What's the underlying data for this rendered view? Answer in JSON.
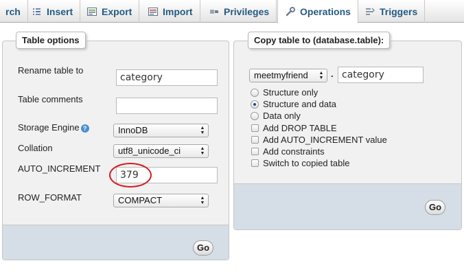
{
  "tabs": [
    {
      "label": "rch",
      "icon": "search-icon"
    },
    {
      "label": "Insert",
      "icon": "insert-icon"
    },
    {
      "label": "Export",
      "icon": "export-icon"
    },
    {
      "label": "Import",
      "icon": "import-icon"
    },
    {
      "label": "Privileges",
      "icon": "privileges-icon"
    },
    {
      "label": "Operations",
      "icon": "wrench-icon",
      "active": true
    },
    {
      "label": "Triggers",
      "icon": "triggers-icon"
    }
  ],
  "table_options": {
    "legend": "Table options",
    "rename_label": "Rename table to",
    "rename_value": "category",
    "comments_label": "Table comments",
    "comments_value": "",
    "engine_label": "Storage Engine",
    "engine_value": "InnoDB",
    "collation_label": "Collation",
    "collation_value": "utf8_unicode_ci",
    "auto_inc_label": "AUTO_INCREMENT",
    "auto_inc_value": "379",
    "row_format_label": "ROW_FORMAT",
    "row_format_value": "COMPACT",
    "go_label": "Go"
  },
  "copy_table": {
    "legend": "Copy table to (database.table):",
    "database_value": "meetmyfriend",
    "separator": ".",
    "table_value": "category",
    "options": [
      {
        "type": "radio",
        "label": "Structure only",
        "checked": false
      },
      {
        "type": "radio",
        "label": "Structure and data",
        "checked": true
      },
      {
        "type": "radio",
        "label": "Data only",
        "checked": false
      },
      {
        "type": "checkbox",
        "label": "Add DROP TABLE",
        "checked": false
      },
      {
        "type": "checkbox",
        "label": "Add AUTO_INCREMENT value",
        "checked": false
      },
      {
        "type": "checkbox",
        "label": "Add constraints",
        "checked": false
      },
      {
        "type": "checkbox",
        "label": "Switch to copied table",
        "checked": false
      }
    ],
    "go_label": "Go"
  },
  "colors": {
    "tab_text": "#235a81",
    "footer_bg": "#d5dde6",
    "highlight_ring": "#d4171c"
  }
}
